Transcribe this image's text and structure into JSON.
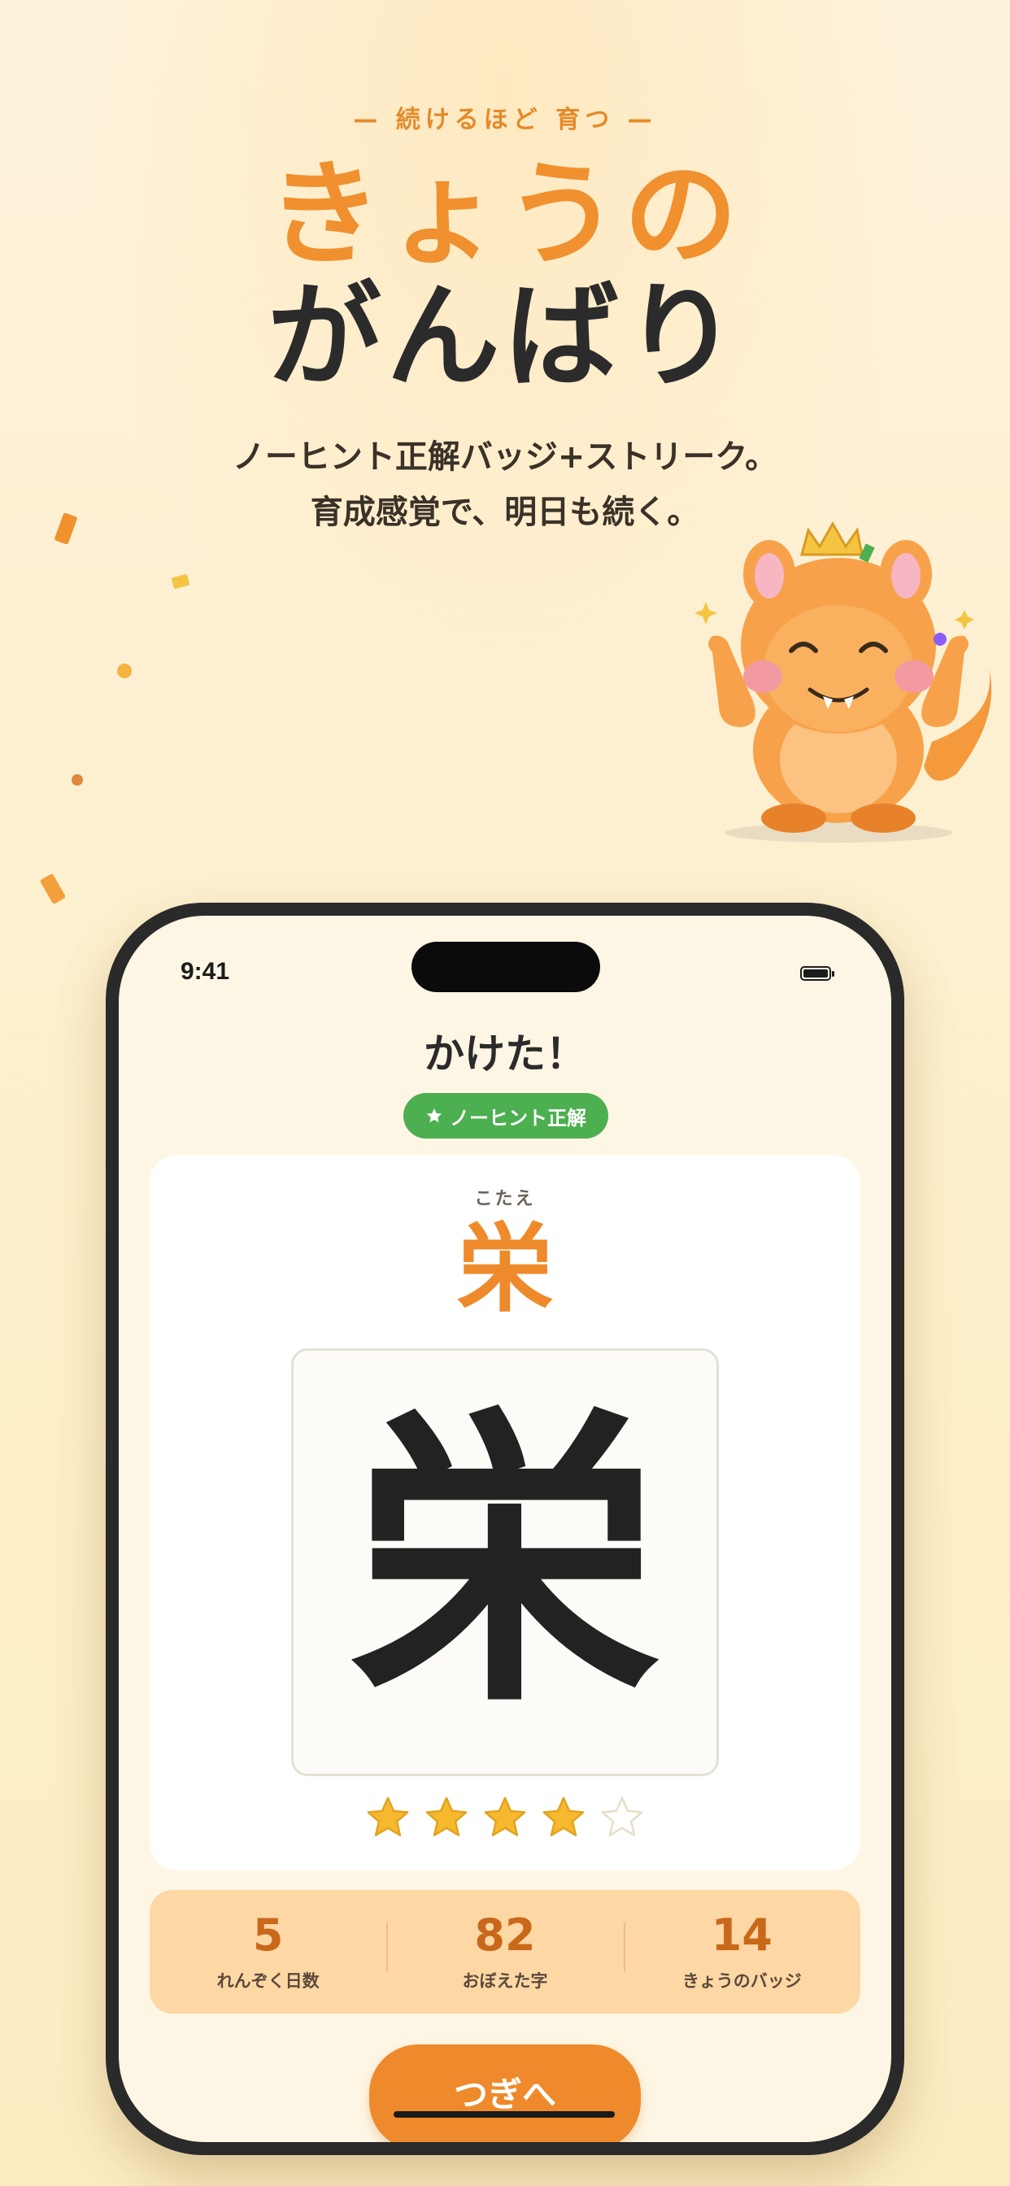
{
  "header": {
    "eyebrow": "— 続けるほど 育つ —",
    "title_line1": "きょうの",
    "title_line2": "がんばり",
    "subtitle_line1": "ノーヒント正解バッジ+ストリーク。",
    "subtitle_line2": "育成感覚で、明日も続く。"
  },
  "status_bar": {
    "time": "9:41"
  },
  "result": {
    "title": "かけた！",
    "badge_icon": "star-icon",
    "badge_label": "ノーヒント正解",
    "answer_label": "こたえ",
    "answer_kanji": "栄",
    "written_kanji": "栄",
    "rating": 4,
    "rating_max": 5
  },
  "stats": [
    {
      "value": "5",
      "label": "れんぞく日数"
    },
    {
      "value": "82",
      "label": "おぼえた字"
    },
    {
      "value": "14",
      "label": "きょうのバッジ"
    }
  ],
  "next_button": {
    "label": "つぎへ"
  },
  "colors": {
    "accent_orange": "#ee8a2b",
    "badge_green": "#4caf50",
    "stats_bg": "#fdd7a4",
    "star_gold": "#f5b82e"
  }
}
